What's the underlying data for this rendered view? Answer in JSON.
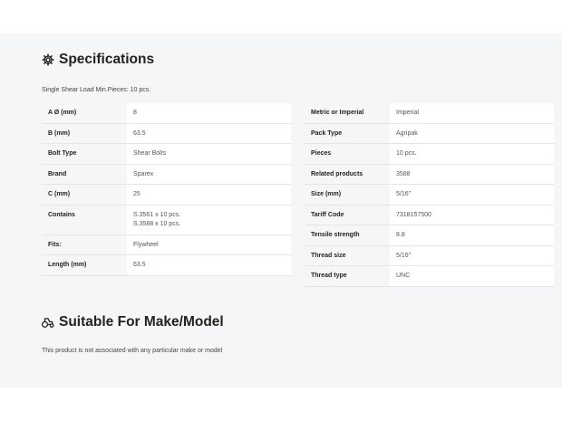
{
  "specifications": {
    "heading": "Specifications",
    "icon": "gear-icon",
    "subtitle": "Single Shear Load Min.Pieces: 10 pcs.",
    "left": [
      {
        "key": "A Ø (mm)",
        "value": "8"
      },
      {
        "key": "B (mm)",
        "value": "63.5"
      },
      {
        "key": "Bolt Type",
        "value": "Shear Bolts"
      },
      {
        "key": "Brand",
        "value": "Sparex"
      },
      {
        "key": "C (mm)",
        "value": "25"
      },
      {
        "key": "Contains",
        "values": [
          "S.3561 x 10 pcs.",
          "S.3588 x 10 pcs."
        ]
      },
      {
        "key": "Fits:",
        "value": "Flywheel"
      },
      {
        "key": "Length (mm)",
        "value": "63.5"
      }
    ],
    "right": [
      {
        "key": "Metric or Imperial",
        "value": "Imperial"
      },
      {
        "key": "Pack Type",
        "value": "Agripak"
      },
      {
        "key": "Pieces",
        "value": "10 pcs."
      },
      {
        "key": "Related products",
        "value": "3588"
      },
      {
        "key": "Size (mm)",
        "value": "5/16''"
      },
      {
        "key": "Tariff Code",
        "value": "7318157500"
      },
      {
        "key": "Tensile strength",
        "value": "8.8"
      },
      {
        "key": "Thread size",
        "value": "5/16''"
      },
      {
        "key": "Thread type",
        "value": "UNC"
      }
    ]
  },
  "suitable": {
    "heading": "Suitable For Make/Model",
    "icon": "tractor-icon",
    "text": "This product is not associated with any particular make or model"
  }
}
